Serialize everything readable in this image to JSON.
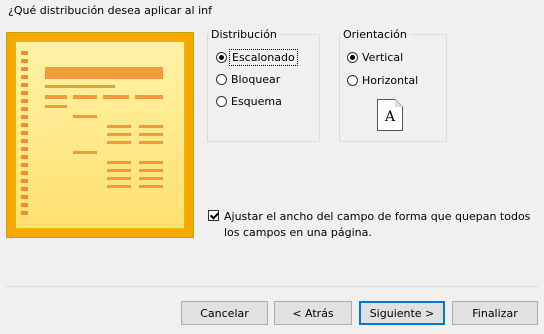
{
  "heading": "¿Qué distribución desea aplicar al inf",
  "distribution": {
    "legend": "Distribución",
    "options": [
      {
        "label": "Escalonado",
        "checked": true
      },
      {
        "label": "Bloquear",
        "checked": false
      },
      {
        "label": "Esquema",
        "checked": false
      }
    ]
  },
  "orientation": {
    "legend": "Orientación",
    "options": [
      {
        "label": "Vertical",
        "checked": true
      },
      {
        "label": "Horizontal",
        "checked": false
      }
    ],
    "page_icon_letter": "A"
  },
  "adjust_width": {
    "checked": true,
    "label": "Ajustar el ancho del campo de forma que quepan todos los campos en una página."
  },
  "buttons": {
    "cancel": "Cancelar",
    "back": "< Atrás",
    "next": "Siguiente >",
    "finish": "Finalizar"
  },
  "colors": {
    "preview_border": "#f5a800",
    "preview_bars": "#f39a3c",
    "default_button": "#0078d7"
  }
}
